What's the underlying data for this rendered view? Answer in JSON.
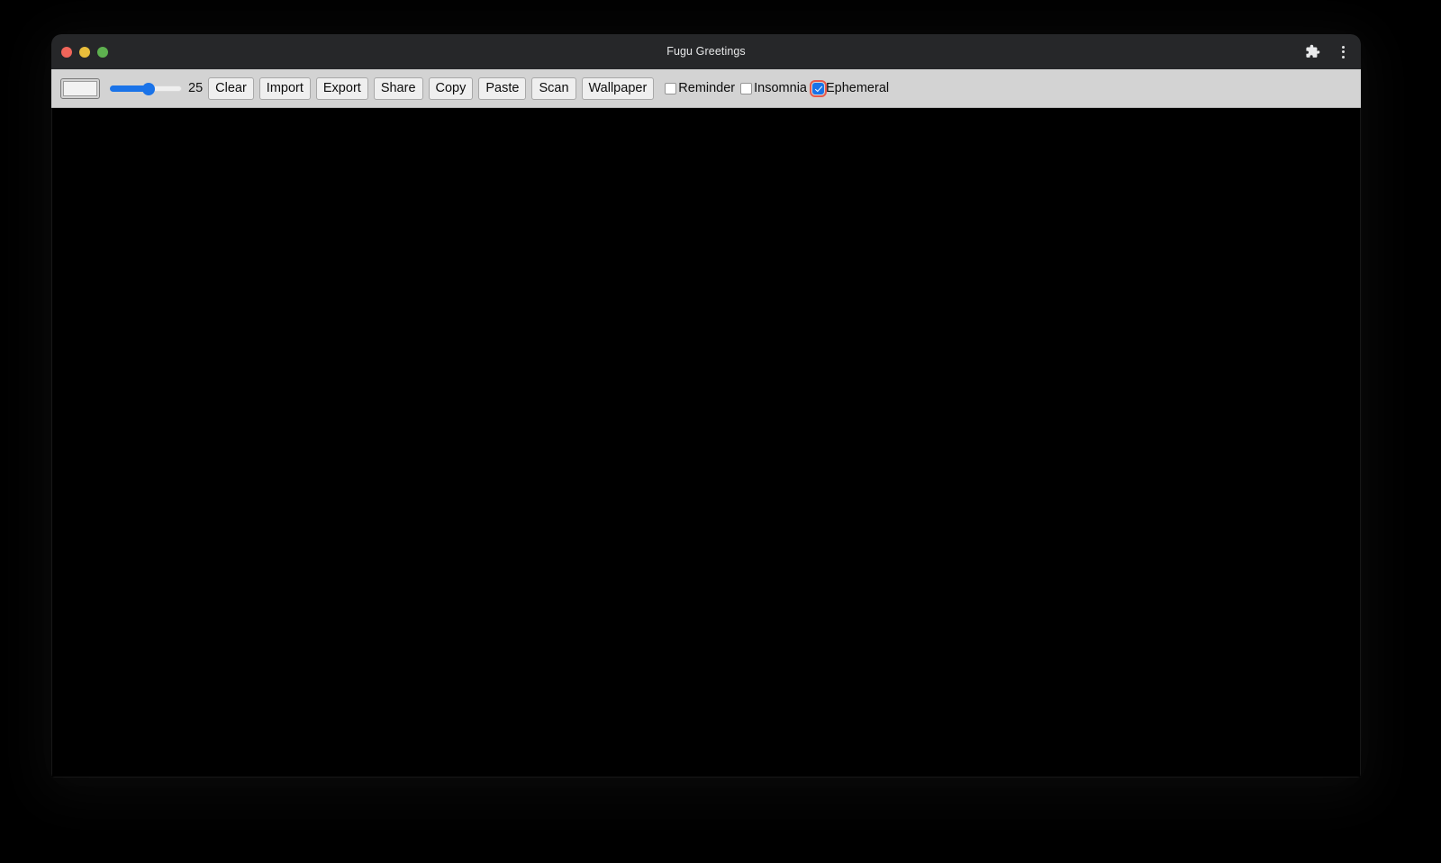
{
  "window": {
    "title": "Fugu Greetings",
    "traffic_lights": [
      {
        "name": "close",
        "color": "#f1655a"
      },
      {
        "name": "minimize",
        "color": "#e8bd3b"
      },
      {
        "name": "maximize",
        "color": "#5eb14f"
      }
    ],
    "titlebar_icons": [
      {
        "name": "extensions-icon",
        "glyph": "puzzle"
      },
      {
        "name": "more-menu-icon",
        "glyph": "three-dots-vertical"
      }
    ],
    "background_color": "#262729"
  },
  "toolbar": {
    "background_color": "#d3d3d3",
    "color_picker": {
      "label": "color-picker",
      "value": "#f2f2f2"
    },
    "slider": {
      "label": "line-width-slider",
      "value": 25,
      "min": 0,
      "max": 50,
      "display_value": "25",
      "accent_color": "#1a73e8"
    },
    "buttons": [
      {
        "name": "clear-button",
        "label": "Clear"
      },
      {
        "name": "import-button",
        "label": "Import"
      },
      {
        "name": "export-button",
        "label": "Export"
      },
      {
        "name": "share-button",
        "label": "Share"
      },
      {
        "name": "copy-button",
        "label": "Copy"
      },
      {
        "name": "paste-button",
        "label": "Paste"
      },
      {
        "name": "scan-button",
        "label": "Scan"
      },
      {
        "name": "wallpaper-button",
        "label": "Wallpaper"
      }
    ],
    "checkboxes": [
      {
        "name": "reminder-checkbox",
        "label": "Reminder",
        "checked": false,
        "focused": false
      },
      {
        "name": "insomnia-checkbox",
        "label": "Insomnia",
        "checked": false,
        "focused": false
      },
      {
        "name": "ephemeral-checkbox",
        "label": "Ephemeral",
        "checked": true,
        "focused": true
      }
    ],
    "focus_ring_color": "#e8594a"
  },
  "canvas": {
    "name": "drawing-canvas",
    "background_color": "#000000"
  }
}
